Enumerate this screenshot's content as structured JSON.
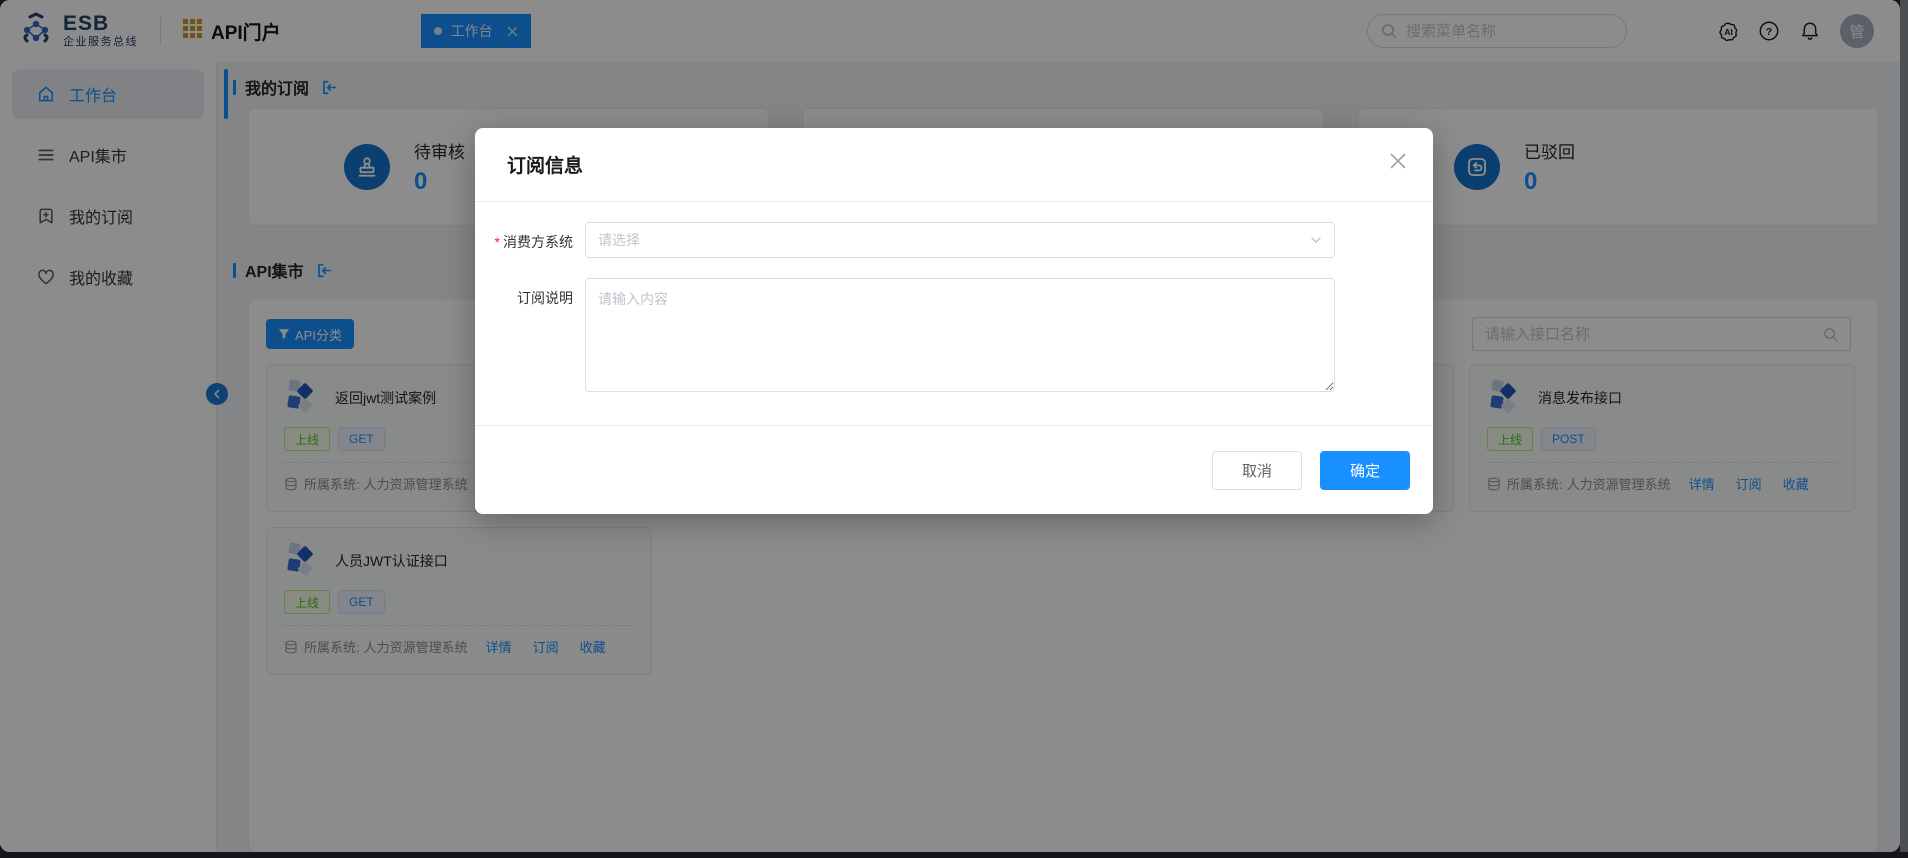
{
  "colors": {
    "accent": "#1890ff",
    "stat_icon_circle": "#1373cc",
    "status_online_green": "#52c41a",
    "mask": "rgba(0,0,0,0.45)"
  },
  "header": {
    "logo_title": "ESB",
    "logo_subtitle": "企业服务总线",
    "portal_title": "API门户",
    "tab": {
      "label": "工作台"
    },
    "search_placeholder": "搜索菜单名称",
    "ai_icon_label": "AI",
    "help_icon_label": "?",
    "avatar_text": "管"
  },
  "sidebar": {
    "items": [
      {
        "label": "工作台"
      },
      {
        "label": "API集市"
      },
      {
        "label": "我的订阅"
      },
      {
        "label": "我的收藏"
      }
    ]
  },
  "subscriptions_section": {
    "title": "我的订阅",
    "stats": [
      {
        "label": "待审核",
        "value": "0"
      },
      {
        "label": "",
        "value": ""
      },
      {
        "label": "已驳回",
        "value": "0"
      }
    ]
  },
  "market_section": {
    "title": "API集市",
    "filter_button_label": "API分类",
    "search_placeholder": "请输入接口名称",
    "system_prefix": "所属系统:",
    "actions": {
      "detail": "详情",
      "subscribe": "订阅",
      "favorite": "收藏"
    },
    "cards": [
      {
        "name": "返回jwt测试案例",
        "status": "上线",
        "method": "GET",
        "system": "人力资源管理系统"
      },
      {
        "name": "消息发布接口",
        "status": "上线",
        "method": "POST",
        "system": "人力资源管理系统"
      },
      {
        "name": "人员JWT认证接口",
        "status": "上线",
        "method": "GET",
        "system": "人力资源管理系统"
      }
    ]
  },
  "modal": {
    "title": "订阅信息",
    "fields": {
      "consumer_system": {
        "label": "消费方系统",
        "required_mark": "*",
        "placeholder": "请选择"
      },
      "description": {
        "label": "订阅说明",
        "placeholder": "请输入内容"
      }
    },
    "cancel_label": "取消",
    "confirm_label": "确定"
  }
}
